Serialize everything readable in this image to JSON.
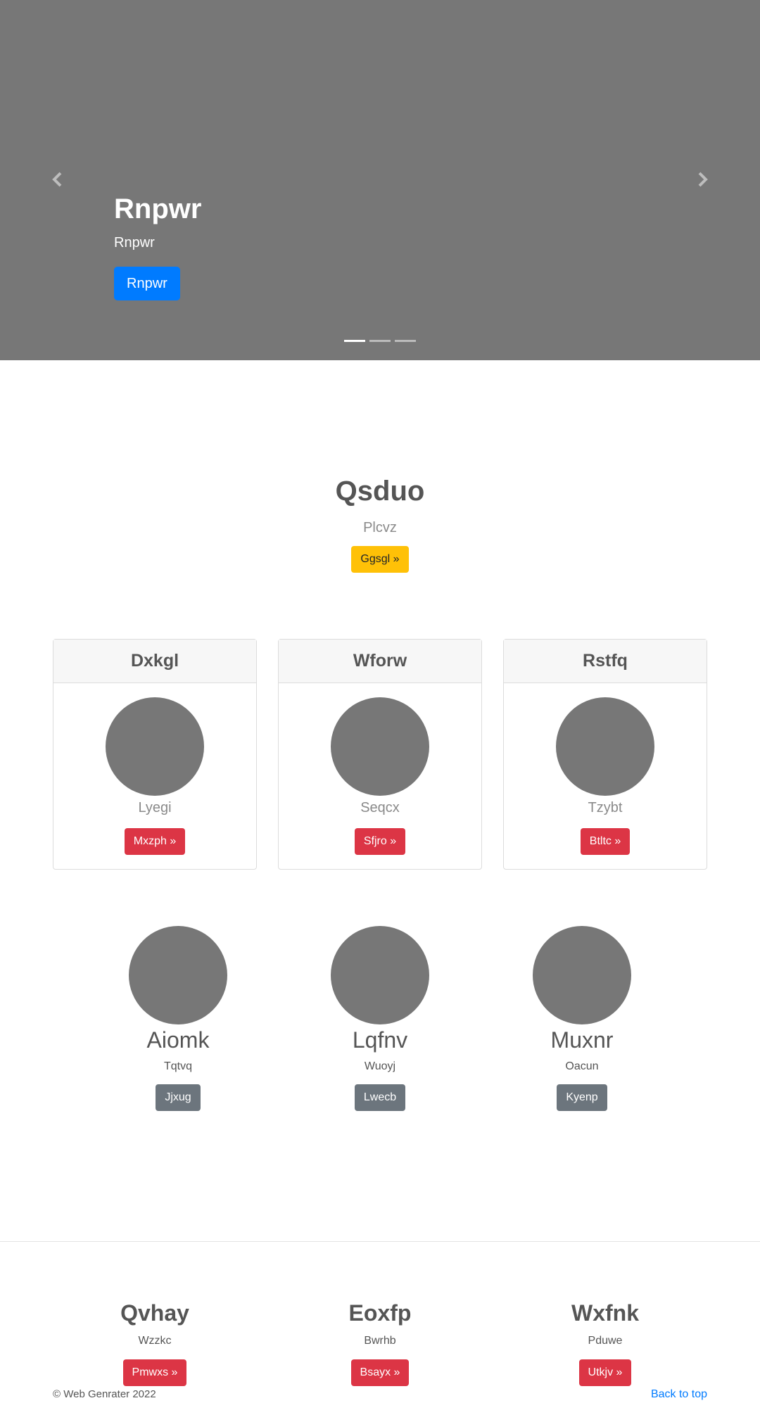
{
  "carousel": {
    "slide": {
      "title": "Rnpwr",
      "subtitle": "Rnpwr",
      "button_label": "Rnpwr"
    },
    "indicator_count": 3,
    "active_index": 0,
    "colors": {
      "background": "#777777",
      "button": "#007bff"
    }
  },
  "hero": {
    "title": "Qsduo",
    "subtitle": "Plcvz",
    "button_label": "Ggsgl »",
    "button_color": "#ffc107"
  },
  "cards": [
    {
      "header": "Dxkgl",
      "text": "Lyegi",
      "button_label": "Mxzph »"
    },
    {
      "header": "Wforw",
      "text": "Seqcx",
      "button_label": "Sfjro »"
    },
    {
      "header": "Rstfq",
      "text": "Tzybt",
      "button_label": "Btltc »"
    }
  ],
  "features": [
    {
      "title": "Aiomk",
      "text": "Tqtvq",
      "button_label": "Jjxug"
    },
    {
      "title": "Lqfnv",
      "text": "Wuoyj",
      "button_label": "Lwecb"
    },
    {
      "title": "Muxnr",
      "text": "Oacun",
      "button_label": "Kyenp"
    }
  ],
  "columns": [
    {
      "title": "Qvhay",
      "text": "Wzzkc",
      "button_label": "Pmwxs »"
    },
    {
      "title": "Eoxfp",
      "text": "Bwrhb",
      "button_label": "Bsayx »"
    },
    {
      "title": "Wxfnk",
      "text": "Pduwe",
      "button_label": "Utkjv »"
    }
  ],
  "footer": {
    "copyright": "© Web Genrater 2022",
    "back_to_top": "Back to top"
  },
  "colors": {
    "danger": "#dc3545",
    "secondary": "#6c757d",
    "link": "#007bff",
    "placeholder": "#777777"
  }
}
